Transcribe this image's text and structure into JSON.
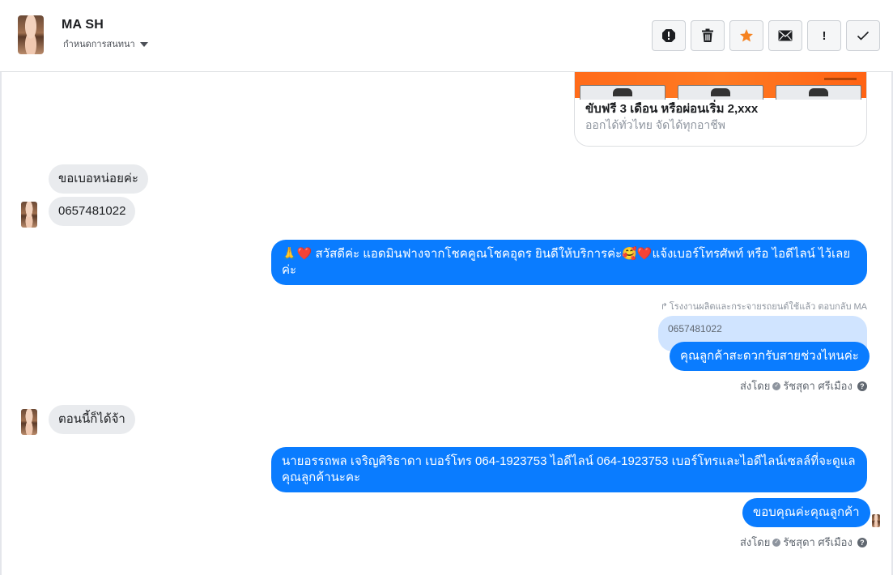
{
  "header": {
    "contact_name": "MA SH",
    "assign_label": "กำหนดการสนทนา"
  },
  "toolbar": {
    "buttons": [
      "spam",
      "delete",
      "star",
      "mark-unread",
      "mark-important",
      "done"
    ],
    "star_color": "#f58220",
    "important_label": "!"
  },
  "link_card": {
    "title": "ขับฟรี 3 เดือน หรือผ่อนเริ่ม 2,xxx",
    "description": "ออกได้ทั่วไทย จัดได้ทุกอาชีพ"
  },
  "messages": {
    "in_1": "ขอเบอหน่อยค่ะ",
    "in_2": "0657481022",
    "out_1": "🙏❤️ สวัสดีค่ะ แอดมินฟางจากโชคคูณโชคอุดร ยินดีให้บริการค่ะ🥰❤️แจ้งเบอร์โทรศัพท์ หรือ ไอดีไลน์  ไว้เลยค่ะ",
    "reply_note": "โรงงานผลิตและกระจายรถยนต์ใช้แล้ว ตอบกลับ MA",
    "quoted_text": "0657481022",
    "out_2": "คุณลูกค้าสะดวกรับสายช่วงไหนค่ะ",
    "sent_by_1": "ส่งโดย",
    "sender_1": "รัชสุดา ศรีเมือง",
    "in_3": "ตอนนี้ก็ได้จ้า",
    "out_3": "นายอรรถพล เจริญศิริธาดา     เบอร์โทร 064-1923753 ไอดีไลน์ 064-1923753   เบอร์โทรและไอดีไลน์เซลล์ที่จะดูแลคุณลูกค้านะคะ",
    "out_4": "ขอบคุณค่ะคุณลูกค้า",
    "sent_by_2": "ส่งโดย",
    "sender_2": "รัชสุดา ศรีเมือง"
  },
  "colors": {
    "outgoing_bubble": "#0a7cff",
    "incoming_bubble": "#e9ebee",
    "quoted_bubble": "#d0e4ff"
  }
}
